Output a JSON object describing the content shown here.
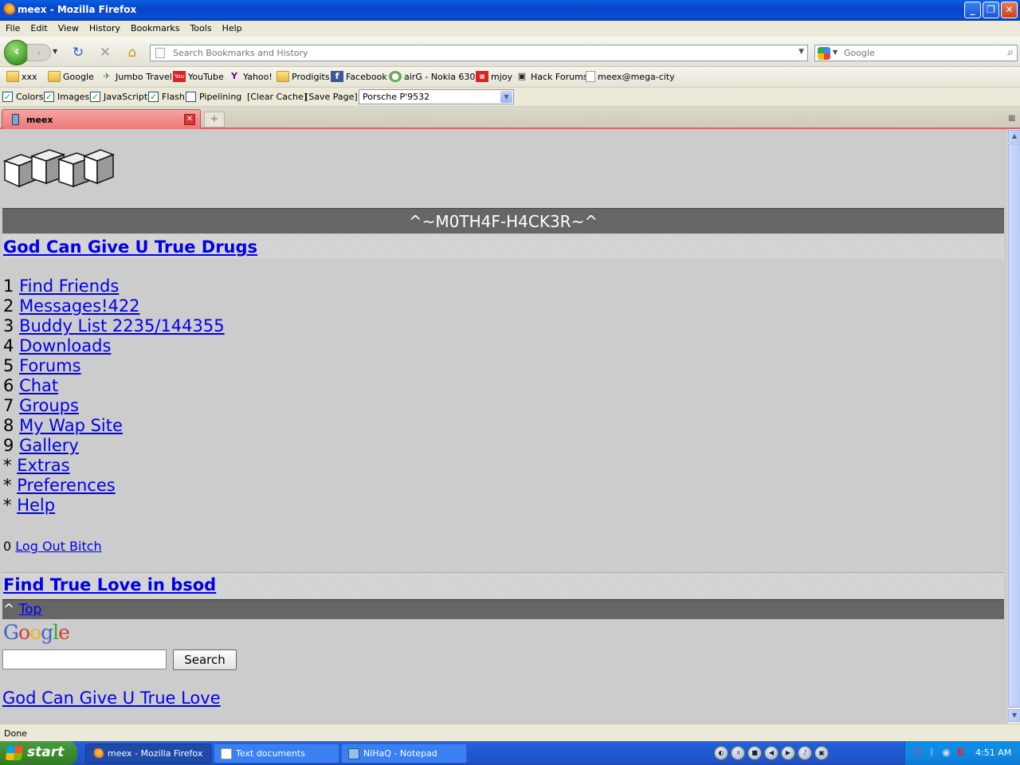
{
  "window": {
    "title": "meex - Mozilla Firefox",
    "buttons": {
      "minimize": "_",
      "maximize": "❐",
      "close": "✕"
    }
  },
  "menu": [
    "File",
    "Edit",
    "View",
    "History",
    "Bookmarks",
    "Tools",
    "Help"
  ],
  "nav": {
    "url_placeholder": "Search Bookmarks and History",
    "search_placeholder": "Google"
  },
  "bookmarks": [
    {
      "label": "xxx",
      "icon": "folder-icon"
    },
    {
      "label": "Google",
      "icon": "folder-icon"
    },
    {
      "label": "Jumbo Travel",
      "icon": "jumbo-icon"
    },
    {
      "label": "YouTube",
      "icon": "youtube-icon"
    },
    {
      "label": "Yahoo!",
      "icon": "yahoo-icon"
    },
    {
      "label": "Prodigits",
      "icon": "folder-icon"
    },
    {
      "label": "Facebook",
      "icon": "facebook-icon"
    },
    {
      "label": "airG - Nokia 6300",
      "icon": "airg-icon"
    },
    {
      "label": "mjoy",
      "icon": "mjoy-icon"
    },
    {
      "label": "Hack Forums",
      "icon": "hackforums-icon"
    },
    {
      "label": "meex@mega-city",
      "icon": "page-icon"
    }
  ],
  "devbar": {
    "checks": [
      {
        "label": "Colors",
        "checked": true
      },
      {
        "label": "Images",
        "checked": true
      },
      {
        "label": "JavaScript",
        "checked": true
      },
      {
        "label": "Flash",
        "checked": true
      },
      {
        "label": "Pipelining",
        "checked": false
      }
    ],
    "clear_cache": "[Clear Cache]",
    "save_page": "[Save Page]",
    "user_agent": "Porsche P'9532"
  },
  "tab": {
    "label": "meex",
    "close": "✕",
    "new": "+"
  },
  "page": {
    "banner": "^~M0TH4F-H4CK3R~^",
    "ad_top": "God Can Give U True Drugs",
    "menu": [
      {
        "key": "1",
        "label": "Find Friends"
      },
      {
        "key": "2",
        "label": "Messages!422"
      },
      {
        "key": "3",
        "label": "Buddy List 2235/144355"
      },
      {
        "key": "4",
        "label": "Downloads"
      },
      {
        "key": "5",
        "label": "Forums"
      },
      {
        "key": "6",
        "label": "Chat"
      },
      {
        "key": "7",
        "label": "Groups"
      },
      {
        "key": "8",
        "label": "My Wap Site"
      },
      {
        "key": "9",
        "label": "Gallery"
      },
      {
        "key": "*",
        "label": "Extras"
      },
      {
        "key": "*",
        "label": "Preferences"
      },
      {
        "key": "*",
        "label": "Help"
      }
    ],
    "logout_key": "0",
    "logout": "Log Out Bitch",
    "ad_bottom": "Find True Love in bsod",
    "top_caret": "^",
    "top_link": "Top",
    "google_search_button": "Search",
    "footer_link": "God Can Give U True Love"
  },
  "status": "Done",
  "taskbar": {
    "start": "start",
    "tasks": [
      {
        "label": "meex - Mozilla Firefox",
        "active": true
      },
      {
        "label": "Text documents",
        "active": false
      },
      {
        "label": "NiHaQ - Notepad",
        "active": false
      }
    ],
    "clock": "4:51 AM"
  },
  "colors": {
    "link": "#0000ee",
    "page_bg": "#cccccc",
    "banner_bg": "#666666"
  }
}
